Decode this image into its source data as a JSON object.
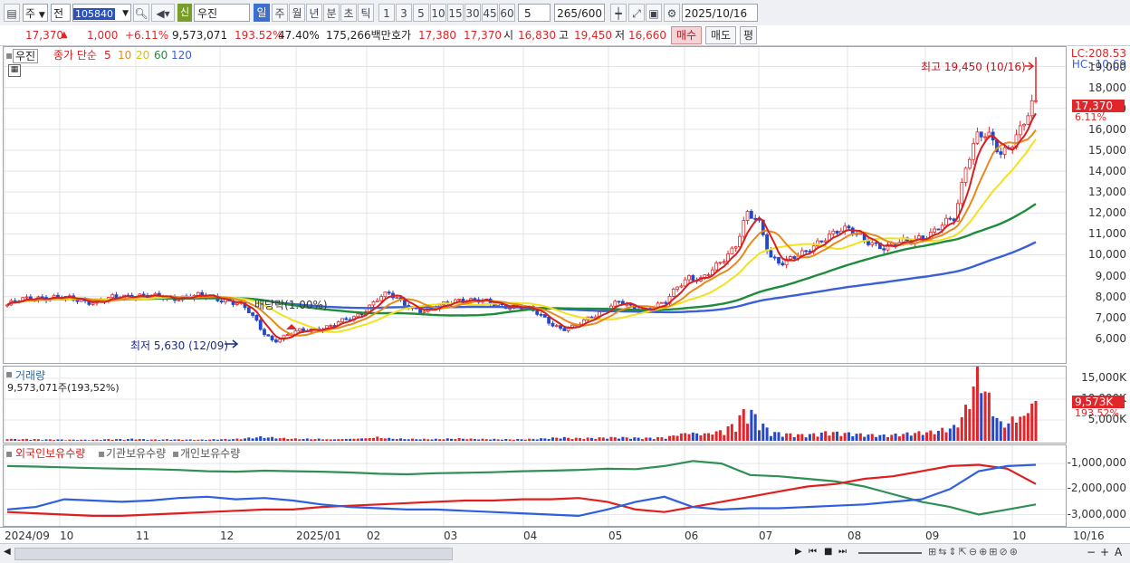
{
  "toolbar": {
    "market": "주",
    "mode": "전",
    "code": "105840",
    "shin": "신",
    "name": "우진",
    "periods": [
      "일",
      "주",
      "월",
      "년",
      "분",
      "초",
      "틱"
    ],
    "nums": [
      "1",
      "3",
      "5",
      "10",
      "15",
      "30",
      "45",
      "60"
    ],
    "unit": "5",
    "count": "265",
    "total": "/600",
    "date": "2025/10/16"
  },
  "quote": {
    "price": "17,370",
    "change_icon": "▲",
    "change": "1,000",
    "pct": "+6.11%",
    "volume": "9,573,071",
    "vol_ratio": "193.52%",
    "turnover": "47.40%",
    "amount": "175,266백만",
    "ask_label": "호가",
    "ask": "17,380",
    "bid": "17,370",
    "open_label": "시",
    "open": "16,830",
    "high_label": "고",
    "high": "19,450",
    "low_label": "저",
    "low": "16,660",
    "buy": "매수",
    "sell": "매도",
    "eval": "평"
  },
  "legend": {
    "name": "우진",
    "ma_label": "종가 단순",
    "ma5": "5",
    "ma10": "10",
    "ma20": "20",
    "ma60": "60",
    "ma120": "120",
    "vol_title": "거래량",
    "vol_value": "9,573,071주(193,52%)",
    "s1": "외국인보유수량",
    "s2": "기관보유수량",
    "s3": "개인보유수량"
  },
  "annotations": {
    "high": "최고 19,450 (10/16)",
    "low": "최저 5,630 (12/09)",
    "dividend": "배당락(1.00%)",
    "lc": "LC:208.53",
    "hc": "HC:-10.69",
    "last_tag": "17,370",
    "last_pct": "6.11%",
    "vol_tag": "9,573K",
    "vol_pct": "193.52%"
  },
  "colors": {
    "up": "#e0262a",
    "down": "#2448c8",
    "ma5": "#d42020",
    "ma10": "#e88a1a",
    "ma20": "#f2e21e",
    "ma60": "#1e8c3a",
    "ma120": "#3a5fd8",
    "s1": "#2f8f55",
    "s2": "#e01e1e",
    "s3": "#2e5fe0"
  },
  "chart_data": {
    "type": "candlestick",
    "price_axis": {
      "min": 5000,
      "max": 19500,
      "ticks": [
        "19,000",
        "18,000",
        "17,000",
        "16,000",
        "15,000",
        "14,000",
        "13,000",
        "12,000",
        "11,000",
        "10,000",
        "9,000",
        "8,000",
        "7,000",
        "6,000"
      ]
    },
    "x_labels": [
      "2024/09",
      "10",
      "11",
      "12",
      "2025/01",
      "02",
      "03",
      "04",
      "05",
      "06",
      "07",
      "08",
      "09",
      "10",
      "10/16"
    ],
    "closes": [
      7600,
      7800,
      7900,
      8000,
      7950,
      7900,
      7850,
      7800,
      7750,
      7900,
      8000,
      8100,
      8050,
      7950,
      7900,
      8000,
      8050,
      8000,
      7900,
      7850,
      7700,
      7200,
      6400,
      5900,
      6100,
      6300,
      6400,
      6500,
      6600,
      6800,
      7000,
      7400,
      7900,
      8100,
      7800,
      7500,
      7300,
      7400,
      7700,
      7900,
      7800,
      7750,
      7700,
      7600,
      7500,
      7400,
      7200,
      6800,
      6400,
      6500,
      6900,
      7200,
      7500,
      7700,
      7500,
      7400,
      7500,
      7700,
      8500,
      9000,
      8800,
      9200,
      9800,
      10500,
      12000,
      11500,
      9900,
      9700,
      9900,
      10000,
      10500,
      11000,
      11200,
      11100,
      10800,
      10600,
      10300,
      10500,
      10700,
      10900,
      11000,
      11400,
      11800,
      14500,
      15800,
      15500,
      14800,
      15500,
      16370,
      17370
    ],
    "volume_axis": {
      "ticks": [
        "15,000K",
        "10,000K",
        "5,000K"
      ]
    },
    "volume_k": [
      400,
      300,
      380,
      260,
      300,
      220,
      240,
      200,
      260,
      350,
      300,
      420,
      280,
      240,
      300,
      260,
      240,
      220,
      300,
      340,
      380,
      600,
      800,
      650,
      500,
      420,
      400,
      380,
      350,
      420,
      480,
      600,
      720,
      500,
      420,
      380,
      360,
      350,
      420,
      480,
      400,
      360,
      340,
      320,
      300,
      360,
      420,
      560,
      700,
      520,
      560,
      600,
      680,
      720,
      640,
      580,
      620,
      720,
      1200,
      1600,
      1300,
      1500,
      2200,
      3500,
      6800,
      4200,
      1800,
      1500,
      1300,
      1200,
      1400,
      1800,
      1600,
      1500,
      1300,
      1200,
      1100,
      1300,
      1500,
      1700,
      1800,
      2300,
      2800,
      6500,
      15000,
      8000,
      3200,
      4200,
      6000,
      9573
    ],
    "holding_axis": {
      "ticks": [
        "-1,000,000",
        "-2,000,000",
        "-3,000,000"
      ]
    },
    "holdings": [
      {
        "name": "외국인보유수량",
        "values": [
          -1100000,
          -1120000,
          -1150000,
          -1180000,
          -1200000,
          -1220000,
          -1250000,
          -1300000,
          -1320000,
          -1280000,
          -1300000,
          -1320000,
          -1350000,
          -1400000,
          -1420000,
          -1380000,
          -1360000,
          -1340000,
          -1300000,
          -1280000,
          -1250000,
          -1200000,
          -1220000,
          -1100000,
          -900000,
          -1000000,
          -1450000,
          -1500000,
          -1600000,
          -1700000,
          -1900000,
          -2200000,
          -2500000,
          -2700000,
          -3000000,
          -2800000,
          -2600000
        ]
      },
      {
        "name": "기관보유수량",
        "values": [
          -2900000,
          -2950000,
          -3000000,
          -3050000,
          -3050000,
          -3000000,
          -2950000,
          -2900000,
          -2850000,
          -2800000,
          -2800000,
          -2700000,
          -2650000,
          -2600000,
          -2550000,
          -2500000,
          -2450000,
          -2450000,
          -2400000,
          -2400000,
          -2350000,
          -2500000,
          -2800000,
          -2900000,
          -2700000,
          -2500000,
          -2300000,
          -2100000,
          -1900000,
          -1800000,
          -1600000,
          -1500000,
          -1300000,
          -1100000,
          -1050000,
          -1200000,
          -1800000
        ]
      },
      {
        "name": "개인보유수량",
        "values": [
          -2800000,
          -2700000,
          -2400000,
          -2450000,
          -2500000,
          -2450000,
          -2350000,
          -2300000,
          -2400000,
          -2350000,
          -2450000,
          -2600000,
          -2700000,
          -2750000,
          -2800000,
          -2800000,
          -2850000,
          -2900000,
          -2950000,
          -3000000,
          -3050000,
          -2800000,
          -2500000,
          -2300000,
          -2700000,
          -2800000,
          -2750000,
          -2750000,
          -2700000,
          -2650000,
          -2600000,
          -2500000,
          -2400000,
          -2000000,
          -1300000,
          -1100000,
          -1050000
        ]
      }
    ]
  }
}
